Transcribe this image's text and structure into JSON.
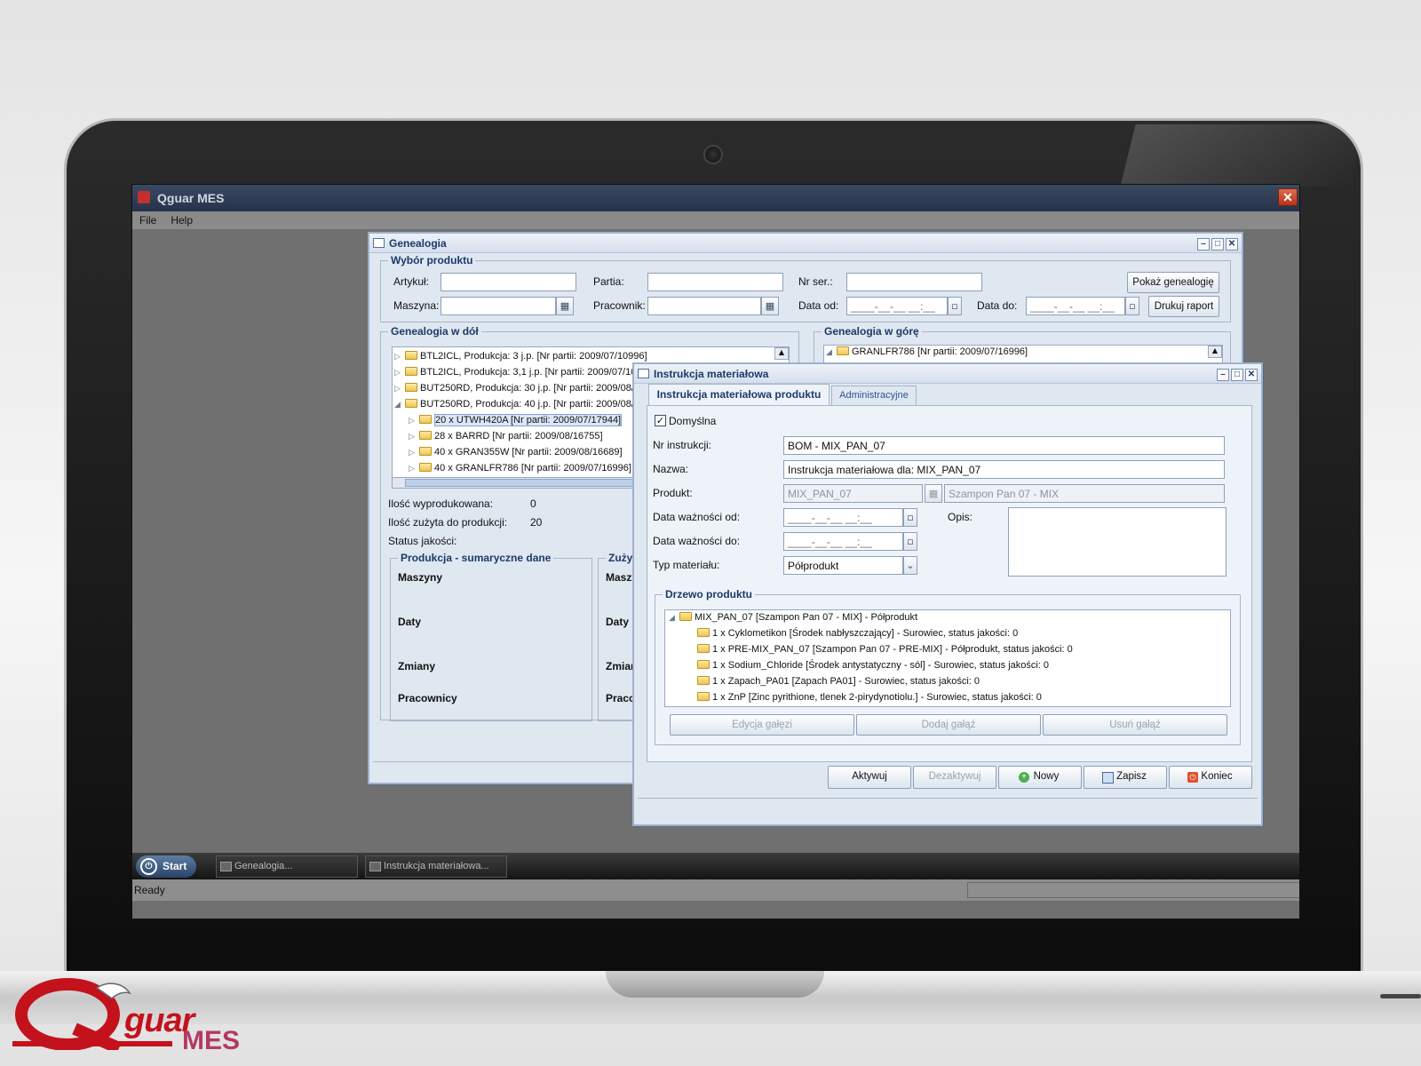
{
  "app": {
    "title": "Qguar MES"
  },
  "menu": [
    "File",
    "Help"
  ],
  "genealogia": {
    "title": "Genealogia",
    "wybor": {
      "title": "Wybór produktu",
      "artykul": "Artykuł:",
      "partia": "Partia:",
      "nr_ser": "Nr ser.:",
      "maszyna": "Maszyna:",
      "pracownik": "Pracownik:",
      "data_od": "Data od:",
      "data_do": "Data do:",
      "date_placeholder": "____-__-__ __:__",
      "pokaz_btn": "Pokaż genealogię",
      "drukuj_btn": "Drukuj raport"
    },
    "down": {
      "title": "Genealogia w dół",
      "items": [
        "BTL2ICL, Produkcja: 3 j.p. [Nr partii: 2009/07/10996]",
        "BTL2ICL, Produkcja: 3,1 j.p. [Nr partii: 2009/07/109",
        "BUT250RD, Produkcja: 30 j.p. [Nr partii: 2009/08/11",
        "BUT250RD, Produkcja: 40 j.p. [Nr partii: 2009/08/11",
        "20 x UTWH420A [Nr partii: 2009/07/17944]",
        "28 x BARRD [Nr partii: 2009/08/16755]",
        "40 x GRAN355W [Nr partii: 2009/08/16689]",
        "40 x GRANLFR786 [Nr partii: 2009/07/16996]"
      ]
    },
    "up": {
      "title": "Genealogia w górę",
      "items": [
        "GRANLFR786 [Nr partii: 2009/07/16996]"
      ]
    },
    "ilosc_wyprod_label": "Ilość wyprodukowana:",
    "ilosc_wyprod_value": "0",
    "ilosc_zuzyta_label": "Ilość zużyta do produkcji:",
    "ilosc_zuzyta_value": "20",
    "status_label": "Status jakości:",
    "produkcja": {
      "title": "Produkcja - sumaryczne dane",
      "rows": [
        "Maszyny",
        "Daty",
        "Zmiany",
        "Pracownicy"
      ]
    },
    "zuzycie": {
      "title": "Zużyc",
      "rows": [
        "Maszy",
        "Daty",
        "Zmian",
        "Pracov"
      ]
    }
  },
  "instrukcja": {
    "title": "Instrukcja materiałowa",
    "tabs": [
      "Instrukcja materiałowa produktu",
      "Administracyjne"
    ],
    "domyslna": "Domyślna",
    "nr_label": "Nr instrukcji:",
    "nr_value": "BOM - MIX_PAN_07",
    "nazwa_label": "Nazwa:",
    "nazwa_value": "Instrukcja materiałowa dla: MIX_PAN_07",
    "produkt_label": "Produkt:",
    "produkt_code": "MIX_PAN_07",
    "produkt_name": "Szampon Pan 07 - MIX",
    "wazn_od_label": "Data ważności od:",
    "wazn_do_label": "Data ważności do:",
    "date_placeholder": "____-__-__ __:__",
    "typ_label": "Typ materiału:",
    "typ_value": "Półprodukt",
    "opis_label": "Opis:",
    "drzewo": {
      "title": "Drzewo produktu",
      "root": "MIX_PAN_07 [Szampon Pan 07 - MIX] - Półprodukt",
      "items": [
        "1 x Cyklometikon [Środek nabłyszczający] - Surowiec, status jakości: 0",
        "1 x PRE-MIX_PAN_07 [Szampon Pan 07 - PRE-MIX] - Półprodukt, status jakości: 0",
        "1 x Sodium_Chloride [Środek antystatyczny - sól] - Surowiec, status jakości: 0",
        "1 x Zapach_PA01 [Zapach PA01] - Surowiec, status jakości: 0",
        "1 x ZnP [Zinc pyrithione, tlenek 2-pirydynotiolu.] - Surowiec, status jakości: 0"
      ],
      "btn_edycja": "Edycja gałęzi",
      "btn_dodaj": "Dodaj gałąź",
      "btn_usun": "Usuń gałąź"
    },
    "buttons": {
      "aktywuj": "Aktywuj",
      "dezaktywuj": "Dezaktywuj",
      "nowy": "Nowy",
      "zapisz": "Zapisz",
      "koniec": "Koniec"
    }
  },
  "taskbar": {
    "start": "Start",
    "tasks": [
      "Genealogia...",
      "Instrukcja materiałowa..."
    ]
  },
  "status": "Ready",
  "logo": {
    "text": "guar",
    "mes": "MES"
  }
}
